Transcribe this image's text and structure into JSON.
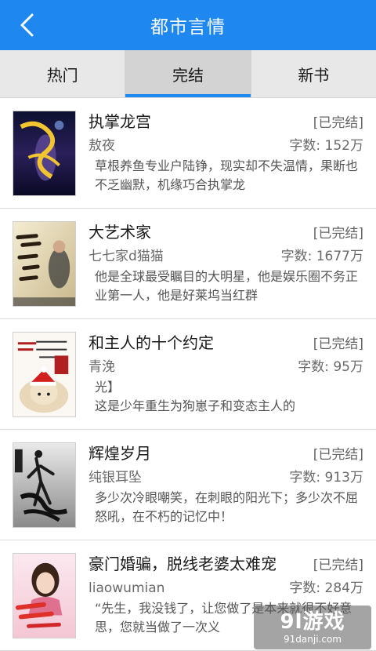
{
  "header": {
    "title": "都市言情",
    "back_icon": "chevron-left-icon"
  },
  "tabs": [
    {
      "label": "热门",
      "active": false
    },
    {
      "label": "完结",
      "active": true
    },
    {
      "label": "新书",
      "active": false
    }
  ],
  "books": [
    {
      "title": "执掌龙宫",
      "status": "[已完结]",
      "author": "敖夜",
      "count": "字数: 152万",
      "desc": "草根养鱼专业户陆铮，现实却不失温情，果断也不乏幽默，机缘巧合执掌龙"
    },
    {
      "title": "大艺术家",
      "status": "[已完结]",
      "author": "七七家d猫猫",
      "count": "字数: 1677万",
      "desc": "他是全球最受瞩目的大明星，他是娱乐圈不务正业第一人，他是好莱坞当红群"
    },
    {
      "title": "和主人的十个约定",
      "status": "[已完结]",
      "author": "青浼",
      "count": "字数: 95万",
      "desc_line1": "光】",
      "desc_line2": "这是少年重生为狗崽子和变态主人的"
    },
    {
      "title": "辉煌岁月",
      "status": "[已完结]",
      "author": "纯银耳坠",
      "count": "字数: 913万",
      "desc": "多少次冷眼嘲笑，在刺眼的阳光下；多少次不屈怒吼，在不朽的记忆中！"
    },
    {
      "title": "豪门婚骗，脱线老婆太难宠",
      "status": "[已完结]",
      "author": "liaowumian",
      "count": "字数: 284万",
      "desc": "“先生，我没钱了，让您做了是本来就很不好意思，您就当做了一次义"
    }
  ],
  "watermark": {
    "main": "9l游戏",
    "url": "91danji.com"
  },
  "colors": {
    "primary": "#1e88f0",
    "tab_bg": "#e8e8e8",
    "tab_active_bg": "#d3d3d3"
  }
}
